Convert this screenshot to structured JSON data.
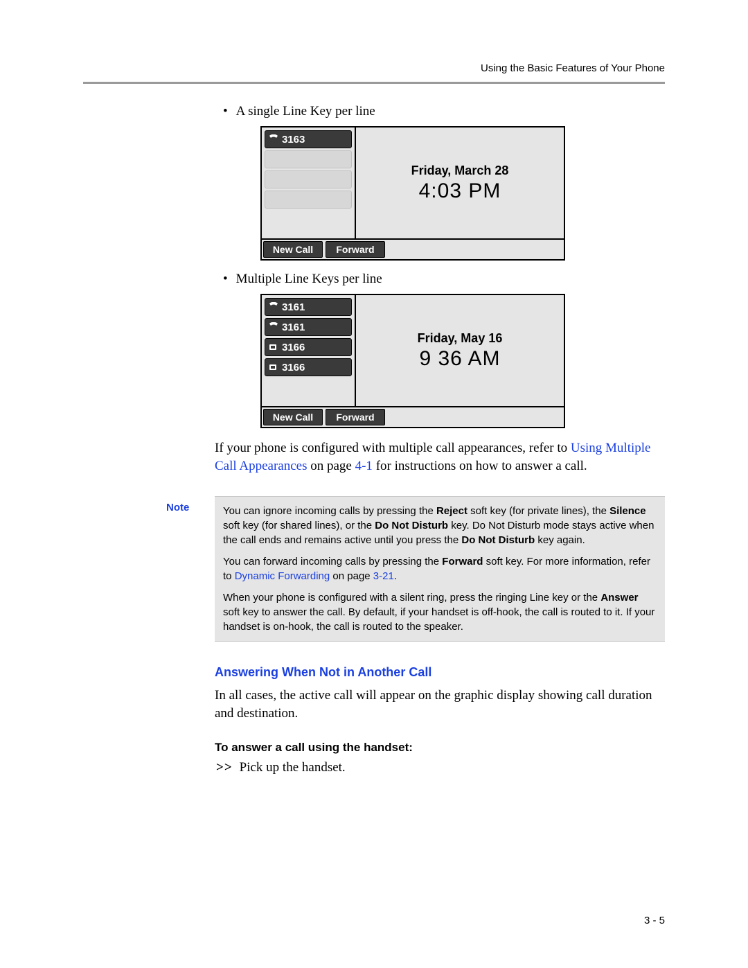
{
  "header": {
    "running_head": "Using the Basic Features of Your Phone"
  },
  "bullets": {
    "single_line": "A single Line Key per line",
    "multi_line": "Multiple Line Keys per line"
  },
  "phone1": {
    "lines": [
      {
        "icon": "phone-icon",
        "label": "3163"
      }
    ],
    "date": "Friday, March 28",
    "time": "4:03 PM",
    "softkeys": {
      "k1": "New Call",
      "k2": "Forward"
    }
  },
  "phone2": {
    "lines": [
      {
        "icon": "phone-icon",
        "label": "3161"
      },
      {
        "icon": "phone-icon",
        "label": "3161"
      },
      {
        "icon": "phone-small-icon",
        "label": "3166"
      },
      {
        "icon": "phone-small-icon",
        "label": "3166"
      }
    ],
    "date": "Friday, May 16",
    "time": "9 36 AM",
    "softkeys": {
      "k1": "New Call",
      "k2": "Forward"
    }
  },
  "para_after_fig2": {
    "pre": "If your phone is configured with multiple call appearances, refer to ",
    "link": "Using Multiple Call Appearances",
    "post1": " on page ",
    "pageref": "4-1",
    "post2": " for instructions on how to answer a call."
  },
  "note": {
    "label": "Note",
    "p1": {
      "t1": "You can ignore incoming calls by pressing the ",
      "b1": "Reject",
      "t2": " soft key (for private lines), the ",
      "b2": "Silence",
      "t3": " soft key (for shared lines), or the ",
      "b3": "Do Not Disturb",
      "t4": " key. Do Not Disturb mode stays active when the call ends and remains active until you press the ",
      "b4": "Do Not Disturb",
      "t5": " key again."
    },
    "p2": {
      "t1": "You can forward incoming calls by pressing the ",
      "b1": "Forward",
      "t2": " soft key. For more information, refer to ",
      "link": "Dynamic Forwarding",
      "t3": " on page ",
      "pageref": "3-21",
      "t4": "."
    },
    "p3": {
      "t1": "When your phone is configured with a silent ring, press the ringing Line key or the ",
      "b1": "Answer",
      "t2": " soft key to answer the call. By default, if your handset is off-hook, the call is routed to it. If your handset is on-hook, the call is routed to the speaker."
    }
  },
  "h_answer": "Answering When Not in Another Call",
  "para_answer": "In all cases, the active call will appear on the graphic display showing call duration and destination.",
  "h_task": "To answer a call using the handset:",
  "step1": {
    "bullet": ">>",
    "text": "Pick up the handset."
  },
  "page_number": "3 - 5"
}
